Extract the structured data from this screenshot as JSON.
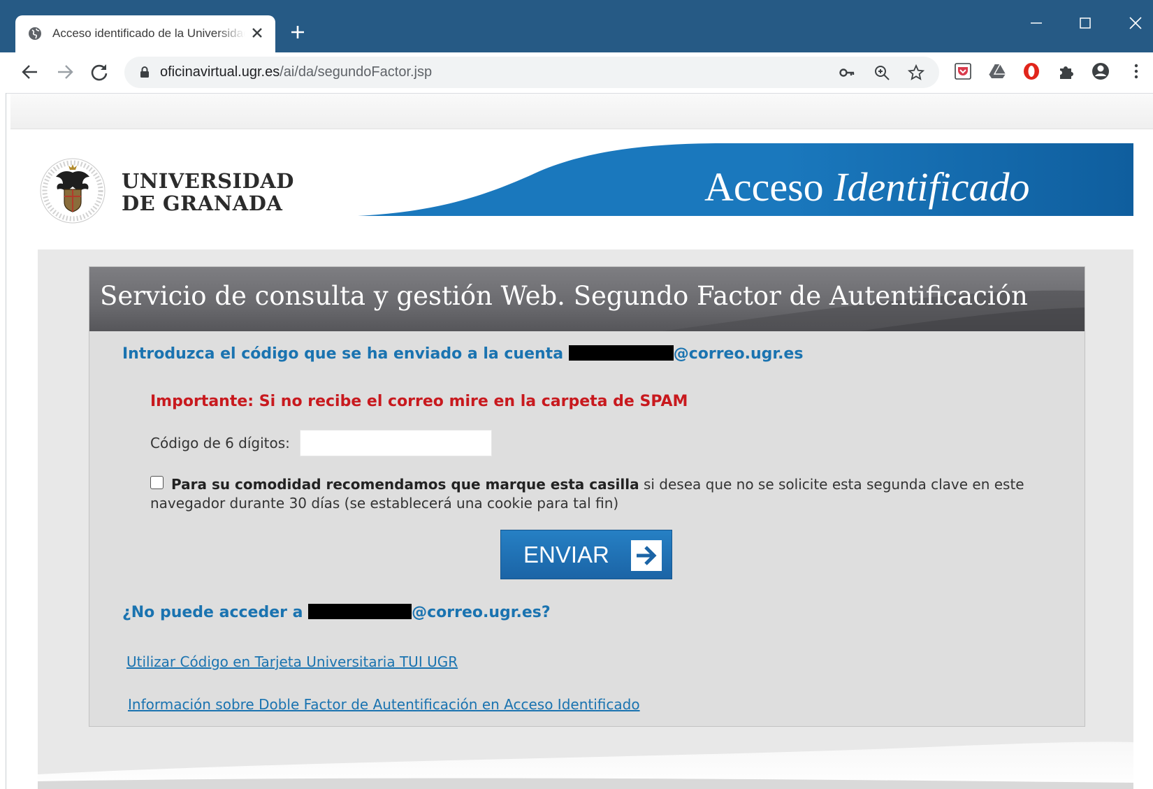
{
  "browser": {
    "tab_title": "Acceso identificado de la Universidad de Granada",
    "url_host": "oficinavirtual.ugr.es",
    "url_path": "/ai/da/segundoFactor.jsp"
  },
  "header": {
    "logo_line1": "UNIVERSIDAD",
    "logo_line2": "DE GRANADA",
    "banner_word1": "Acceso",
    "banner_word2": "Identificado"
  },
  "panel": {
    "title": "Servicio de consulta y gestión Web. Segundo Factor de Autentificación",
    "intro_prefix": "Introduzca el código que se ha enviado a la cuenta ",
    "email_domain": "@correo.ugr.es",
    "important": "Importante: Si no recibe el correo mire en la carpeta de SPAM",
    "code_label": "Código de 6 dígitos:",
    "code_value": "",
    "remember_bold": "Para su comodidad recomendamos que marque esta casilla",
    "remember_rest": " si desea que no se solicite esta segunda clave en este navegador durante 30 días (se establecerá una cookie para tal fin)",
    "remember_checked": false,
    "submit_label": "ENVIAR",
    "noaccess_prefix": "¿No puede acceder a ",
    "noaccess_suffix": "@correo.ugr.es?",
    "link_tui": "Utilizar Código en Tarjeta Universitaria TUI UGR",
    "link_info": "Información sobre Doble Factor de Autentificación en Acceso Identificado"
  },
  "colors": {
    "chrome_frame": "#265a85",
    "link_blue": "#1a73b0",
    "warning_red": "#c8191e",
    "button_blue": "#1f6fb3"
  },
  "icons": [
    "globe-icon",
    "close-icon",
    "plus-icon",
    "minimize-icon",
    "maximize-icon",
    "window-close-icon",
    "back-arrow-icon",
    "forward-arrow-icon",
    "reload-icon",
    "lock-icon",
    "key-icon",
    "zoom-icon",
    "star-icon",
    "pocket-extension-icon",
    "drive-extension-icon",
    "opera-extension-icon",
    "puzzle-extensions-icon",
    "profile-icon",
    "menu-kebab-icon",
    "arrow-right-icon"
  ]
}
